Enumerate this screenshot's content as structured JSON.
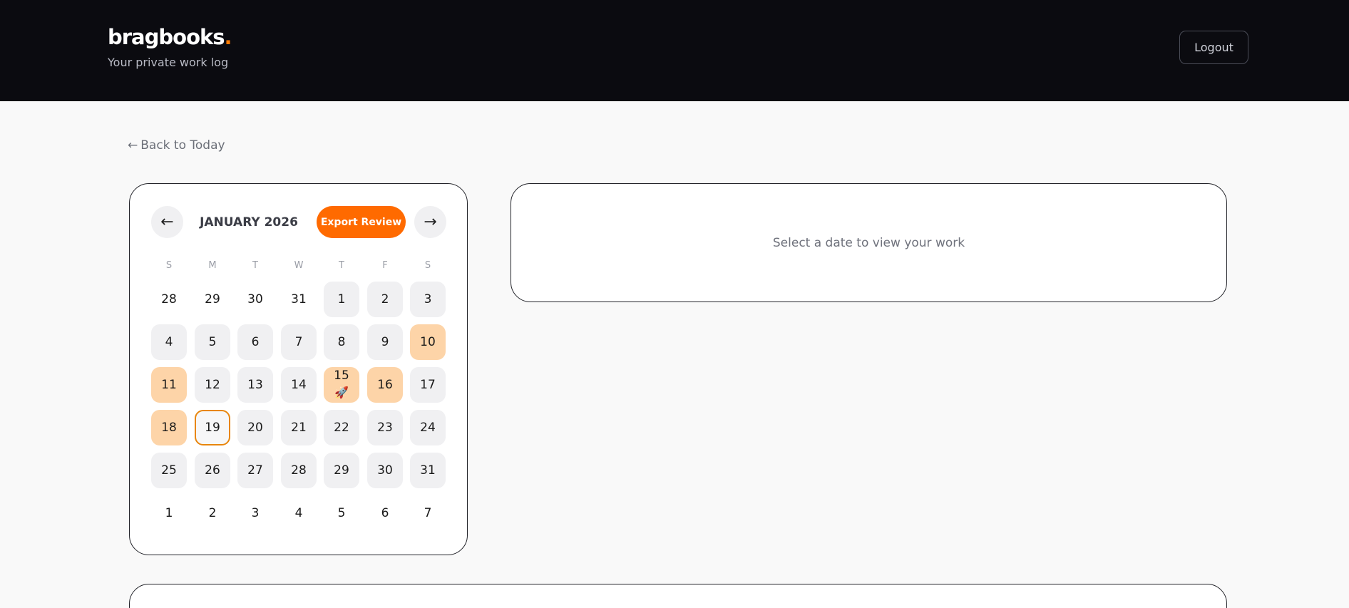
{
  "header": {
    "logo_text": "bragbooks",
    "logo_dot": ".",
    "tagline": "Your private work log",
    "logout_label": "Logout"
  },
  "nav": {
    "back_arrow": "←",
    "back_label": "Back to Today"
  },
  "calendar": {
    "prev_label": "←",
    "next_label": "→",
    "month_label": "JANUARY 2026",
    "export_label": "Export Review",
    "weekdays": [
      "S",
      "M",
      "T",
      "W",
      "T",
      "F",
      "S"
    ],
    "weeks": [
      [
        {
          "day": "28",
          "state": "other"
        },
        {
          "day": "29",
          "state": "other"
        },
        {
          "day": "30",
          "state": "other"
        },
        {
          "day": "31",
          "state": "other"
        },
        {
          "day": "1",
          "state": "current"
        },
        {
          "day": "2",
          "state": "current"
        },
        {
          "day": "3",
          "state": "current"
        }
      ],
      [
        {
          "day": "4",
          "state": "current"
        },
        {
          "day": "5",
          "state": "current"
        },
        {
          "day": "6",
          "state": "current"
        },
        {
          "day": "7",
          "state": "current"
        },
        {
          "day": "8",
          "state": "current"
        },
        {
          "day": "9",
          "state": "current"
        },
        {
          "day": "10",
          "state": "logged"
        }
      ],
      [
        {
          "day": "11",
          "state": "logged"
        },
        {
          "day": "12",
          "state": "current"
        },
        {
          "day": "13",
          "state": "current"
        },
        {
          "day": "14",
          "state": "current"
        },
        {
          "day": "15",
          "state": "logged",
          "emoji": "🚀"
        },
        {
          "day": "16",
          "state": "logged"
        },
        {
          "day": "17",
          "state": "current"
        }
      ],
      [
        {
          "day": "18",
          "state": "logged"
        },
        {
          "day": "19",
          "state": "today"
        },
        {
          "day": "20",
          "state": "current"
        },
        {
          "day": "21",
          "state": "current"
        },
        {
          "day": "22",
          "state": "current"
        },
        {
          "day": "23",
          "state": "current"
        },
        {
          "day": "24",
          "state": "current"
        }
      ],
      [
        {
          "day": "25",
          "state": "current"
        },
        {
          "day": "26",
          "state": "current"
        },
        {
          "day": "27",
          "state": "current"
        },
        {
          "day": "28",
          "state": "current"
        },
        {
          "day": "29",
          "state": "current"
        },
        {
          "day": "30",
          "state": "current"
        },
        {
          "day": "31",
          "state": "current"
        }
      ],
      [
        {
          "day": "1",
          "state": "other"
        },
        {
          "day": "2",
          "state": "other"
        },
        {
          "day": "3",
          "state": "other"
        },
        {
          "day": "4",
          "state": "other"
        },
        {
          "day": "5",
          "state": "other"
        },
        {
          "day": "6",
          "state": "other"
        },
        {
          "day": "7",
          "state": "other"
        }
      ]
    ]
  },
  "detail": {
    "empty_message": "Select a date to view your work"
  },
  "colors": {
    "accent": "#ff6a00",
    "logged_day": "#fdd4a8",
    "today_border": "#e8860d",
    "header_bg": "#0b0b10"
  }
}
